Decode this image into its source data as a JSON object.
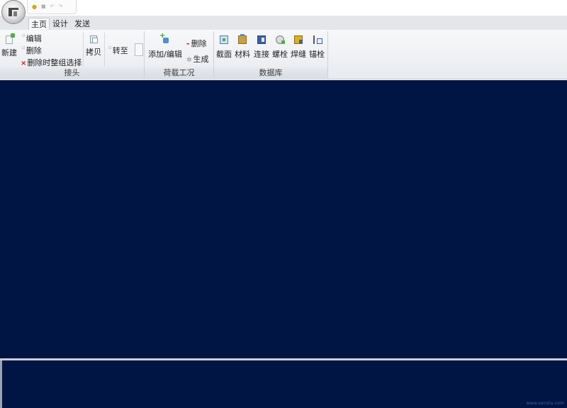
{
  "quick_access": {
    "items": [
      "open-icon",
      "save-icon",
      "undo-icon",
      "redo-icon"
    ]
  },
  "tabs": [
    {
      "label": "主页",
      "active": true
    },
    {
      "label": "设计",
      "active": false
    },
    {
      "label": "发送",
      "active": false
    }
  ],
  "ribbon": {
    "joint_group": {
      "label": "接头",
      "new": "新建",
      "edit": "编辑",
      "delete": "删除",
      "delete_regroup": "删除时整组选择",
      "copy": "拷贝",
      "goto": "转至"
    },
    "load_group": {
      "label": "荷载工况",
      "add_edit": "添加/编辑",
      "delete": "删除",
      "generate": "生成"
    },
    "database_group": {
      "label": "数据库",
      "items": [
        "截面",
        "材料",
        "连接",
        "螺栓",
        "焊缝",
        "锚栓"
      ]
    }
  },
  "colors": {
    "viewport_background": "#001544",
    "ribbon_background": "#eef0f3"
  },
  "watermark": "www.sensta.com"
}
